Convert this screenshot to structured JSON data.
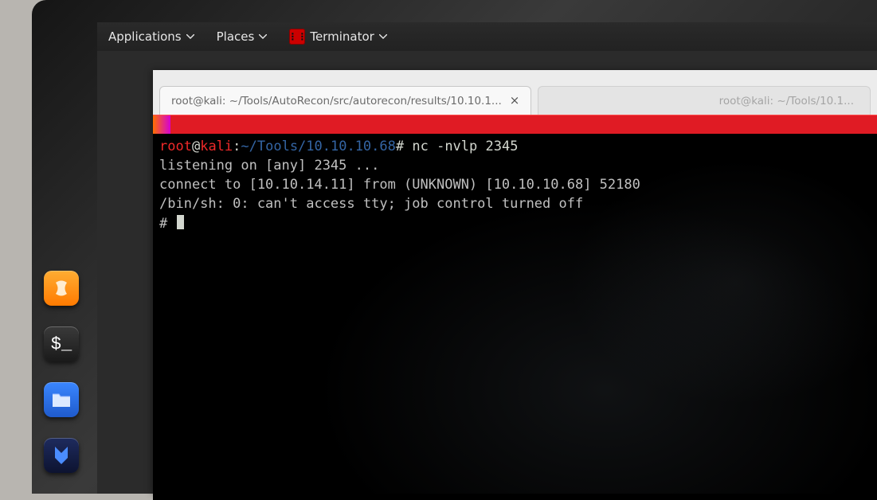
{
  "topbar": {
    "applications": "Applications",
    "places": "Places",
    "terminator": "Terminator"
  },
  "dock": {
    "icon1": "sublime-icon",
    "icon2": "terminal-icon",
    "icon3": "files-icon",
    "icon4": "metasploit-icon"
  },
  "tabs": {
    "active_title": "root@kali: ~/Tools/AutoRecon/src/autorecon/results/10.10.1...",
    "inactive_title": "root@kali: ~/Tools/10.1..."
  },
  "terminal": {
    "prompt": {
      "user": "root",
      "at": "@",
      "host": "kali",
      "sep": ":",
      "path": "~/Tools/10.10.10.68",
      "hash": "#"
    },
    "command": "nc -nvlp 2345",
    "output_line1": "listening on [any] 2345 ...",
    "output_line2": "connect to [10.10.14.11] from (UNKNOWN) [10.10.10.68] 52180",
    "output_line3": "/bin/sh: 0: can't access tty; job control turned off",
    "shell_prompt": "# "
  }
}
